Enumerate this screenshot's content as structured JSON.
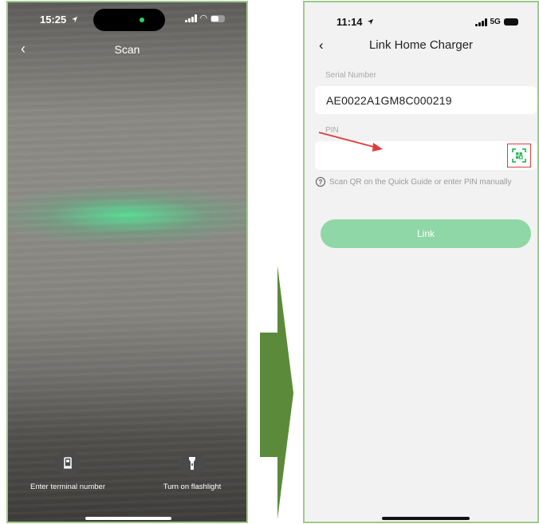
{
  "scan_screen": {
    "time": "15:25",
    "title": "Scan",
    "back_glyph": "‹",
    "enter_terminal_label": "Enter terminal number",
    "flashlight_label": "Turn on flashlight",
    "scan_line_color": "#3ee08a"
  },
  "link_screen": {
    "time": "11:14",
    "network": "5G",
    "back_glyph": "‹",
    "title": "Link Home Charger",
    "serial_label": "Serial Number",
    "serial_value": "AE0022A1GM8C000219",
    "pin_label": "PIN",
    "pin_value": "",
    "hint_icon": "?",
    "hint_text": "Scan QR on the Quick Guide or enter PIN manually",
    "link_button_label": "Link",
    "accent_color": "#8fd7a6",
    "highlight_color": "#e23a3a"
  },
  "transition_arrow_color": "#5b8a3a",
  "icons": [
    "back-chevron-icon",
    "terminal-number-icon",
    "flashlight-icon",
    "qr-scan-icon",
    "help-circle-icon",
    "location-arrow-icon",
    "signal-icon",
    "wifi-icon",
    "battery-icon"
  ]
}
